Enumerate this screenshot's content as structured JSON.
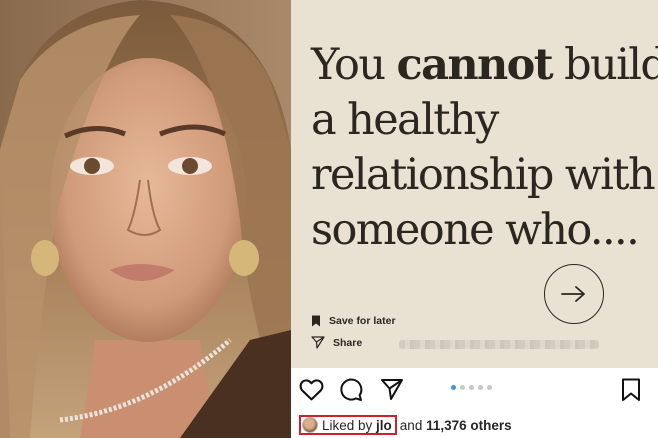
{
  "post": {
    "quote": {
      "line1_pre": "You ",
      "line1_bold": "cannot",
      "line1_post": " build",
      "line2": "a healthy",
      "line3": "relationship with",
      "line4": "someone who...."
    },
    "save_label": "Save for later",
    "share_label": "Share",
    "card_background": "#e9e2d3",
    "text_color": "#2b2620"
  },
  "carousel": {
    "total": 5,
    "current": 1,
    "active_color": "#3897f0"
  },
  "actions": {
    "icons": [
      "heart-icon",
      "comment-icon",
      "send-icon",
      "bookmark-icon"
    ]
  },
  "likes": {
    "prefix": "Liked by ",
    "user": "jlo",
    "suffix": "and ",
    "count": "11,376 others",
    "highlight_color": "#d0202a"
  }
}
